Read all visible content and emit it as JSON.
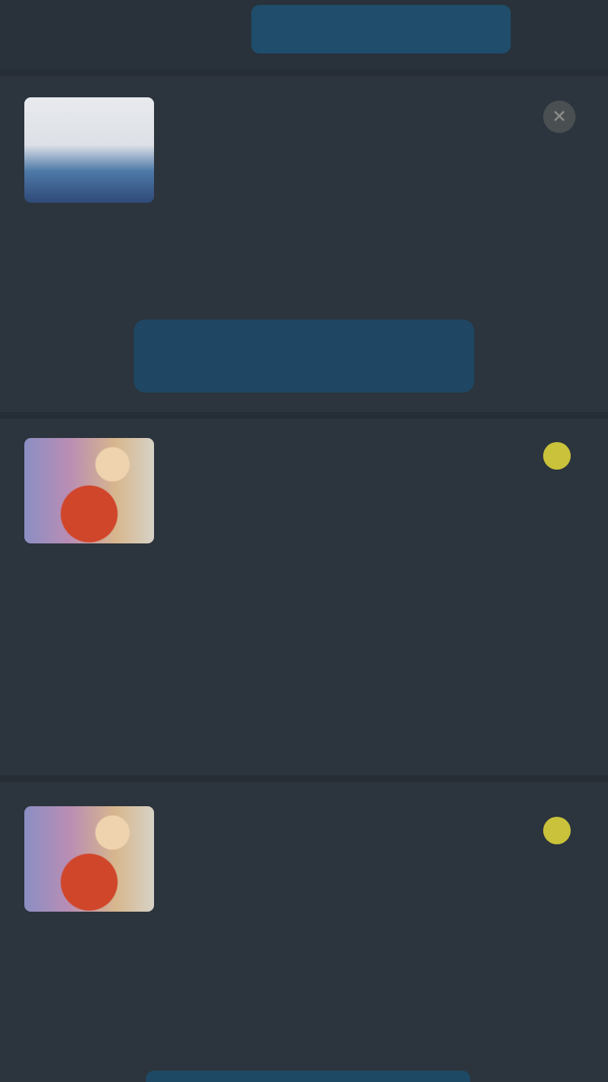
{
  "tabs": {
    "left_label": "",
    "right_label": ""
  },
  "posts": [
    {
      "name": "",
      "meta": "",
      "body": "",
      "action_label": "",
      "close_icon": "close-icon"
    },
    {
      "name": "",
      "meta": "",
      "tag": "",
      "body": "",
      "more_label": ""
    },
    {
      "name": "",
      "meta": "",
      "tag": "",
      "body": ""
    }
  ],
  "colors": {
    "background": "#2c343d",
    "accent": "#1f4d6b",
    "badge": "#c9c23a"
  }
}
